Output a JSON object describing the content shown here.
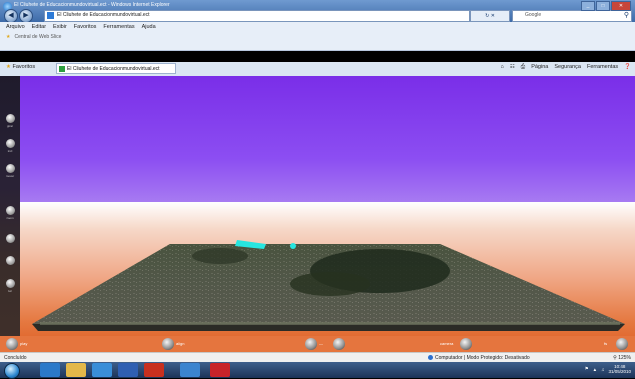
{
  "browser": {
    "window_title": "El Cliuhete de Educacionmundovirtual.ect - Windows Internet Explorer",
    "address_url": "El Cliuhete de Educacionmundovirtual.ect",
    "search_placeholder": "Google",
    "menus": [
      "Arquivo",
      "Editar",
      "Exibir",
      "Favoritos",
      "Ferramentas",
      "Ajuda"
    ],
    "suggestion_text": "Central de Web Slice",
    "favorites_label": "Favoritos",
    "tab_title": "El Cliuhete de Educacionmundovirtual.ect",
    "command_items": [
      "Página",
      "Segurança",
      "Ferramentas"
    ]
  },
  "viewer": {
    "left_controls": [
      {
        "name": "rotate-control",
        "label": "girar"
      },
      {
        "name": "tilt-control",
        "label": "incl"
      },
      {
        "name": "move-control",
        "label": "mover"
      },
      {
        "name": "zoom-in-control",
        "label": "zoom"
      },
      {
        "name": "view-control-1",
        "label": ""
      },
      {
        "name": "view-control-2",
        "label": ""
      },
      {
        "name": "view-control-3",
        "label": "luz"
      }
    ],
    "bottom_controls": [
      {
        "name": "bottom-control-1",
        "label": "play"
      },
      {
        "name": "bottom-control-2",
        "label": "align"
      },
      {
        "name": "bottom-control-3",
        "label": ""
      },
      {
        "name": "bottom-control-4",
        "label": "camera"
      },
      {
        "name": "bottom-control-5",
        "label": "fs"
      }
    ]
  },
  "status": {
    "left_text": "Concluído",
    "mode_text": "Computador | Modo Protegido: Desativado",
    "zoom_text": "125%"
  },
  "taskbar": {
    "apps": [
      "explorer",
      "folder",
      "media",
      "word",
      "acrobat",
      "ie",
      "mcafee"
    ],
    "clock_time": "10:48",
    "clock_date": "31/05/2010"
  },
  "colors": {
    "sky_top": "#7a2ee8",
    "ground_bottom": "#dd5e23",
    "marker_cyan": "#27e6e0"
  }
}
